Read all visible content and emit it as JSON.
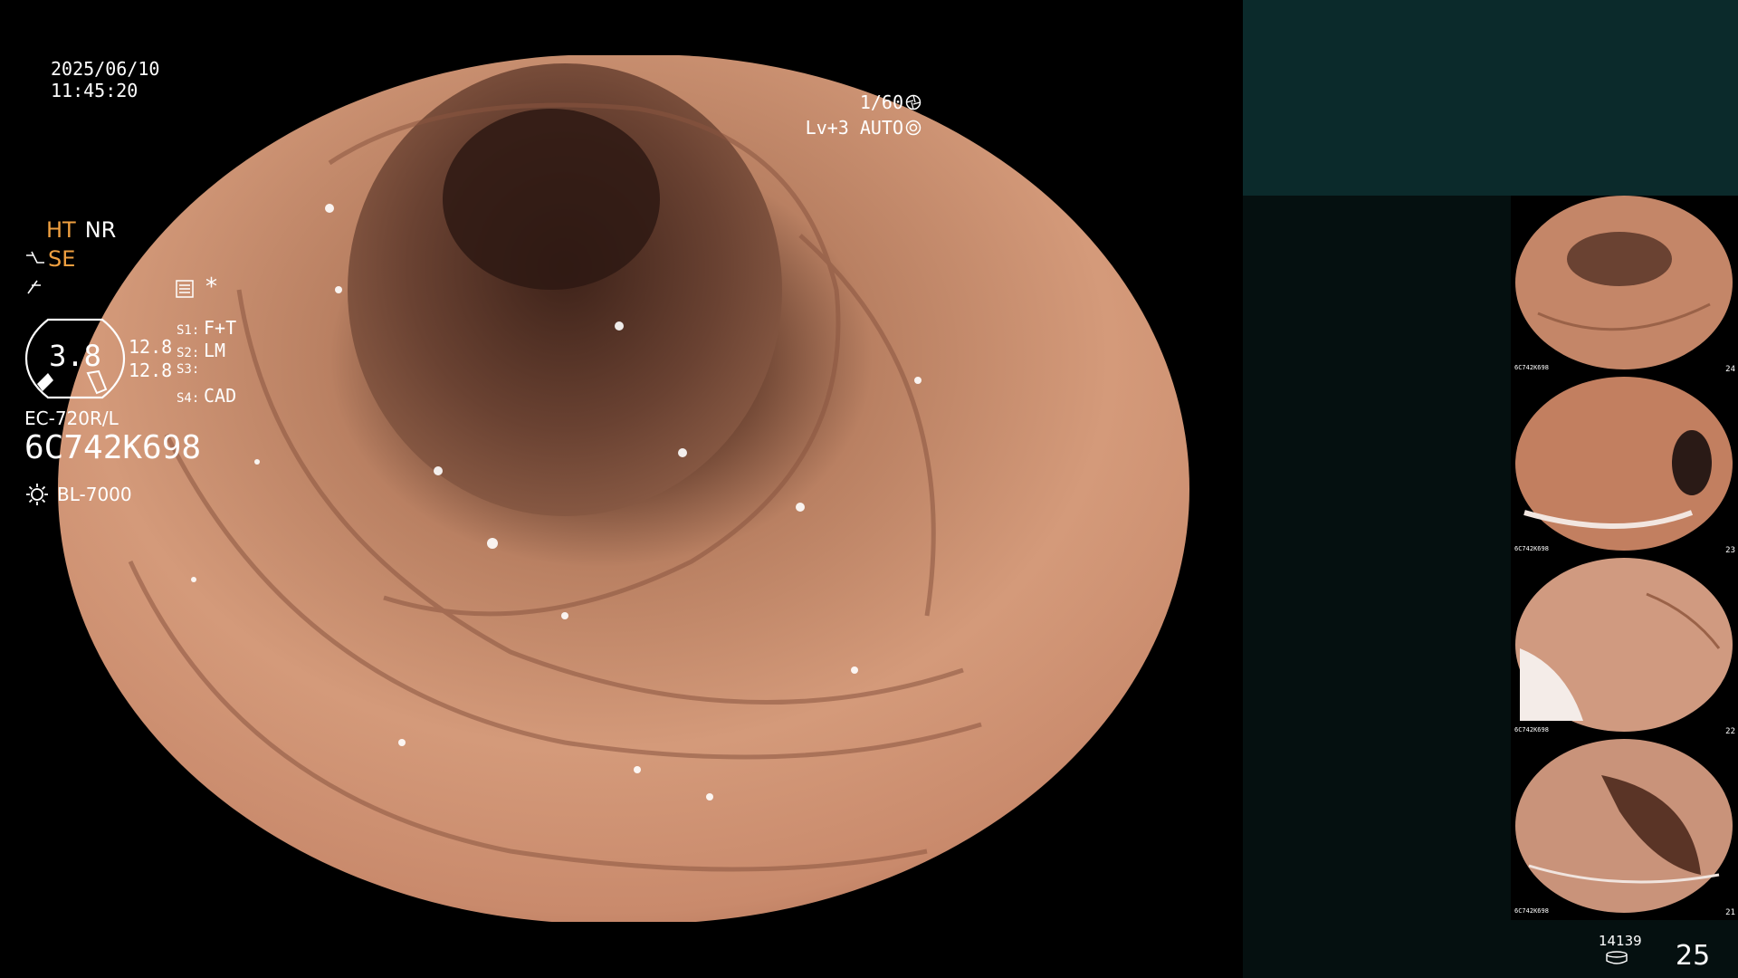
{
  "overlay": {
    "date": "2025/06/10",
    "time": "11:45:20",
    "shutter": "1/60",
    "brightness": "Lv+3",
    "iris": "AUTO"
  },
  "panel": {
    "mode_ht": "HT",
    "mode_nr": "NR",
    "mode_se": "SE",
    "star": "*",
    "gauge_value": "3.8",
    "gauge_side_1": "12.8",
    "gauge_side_2": "12.8",
    "switches": [
      {
        "key": "S1:",
        "value": "F+T"
      },
      {
        "key": "S2:",
        "value": "LM"
      },
      {
        "key": "S3:",
        "value": ""
      },
      {
        "key": "S4:",
        "value": "CAD"
      }
    ],
    "scope_model": "EC-720R/L",
    "scope_serial": "6C742K698",
    "light_source": "BL-7000"
  },
  "thumbnails": [
    {
      "index": "24",
      "serial": "6C742K698"
    },
    {
      "index": "23",
      "serial": "6C742K698"
    },
    {
      "index": "22",
      "serial": "6C742K698"
    },
    {
      "index": "21",
      "serial": "6C742K698"
    }
  ],
  "storage": {
    "remaining": "14139",
    "captured": "25"
  },
  "colors": {
    "panel_bg": "#051010",
    "panel_header": "#0b2a2b",
    "accent_orange": "#f0a040",
    "tissue": "#c98a6c"
  }
}
